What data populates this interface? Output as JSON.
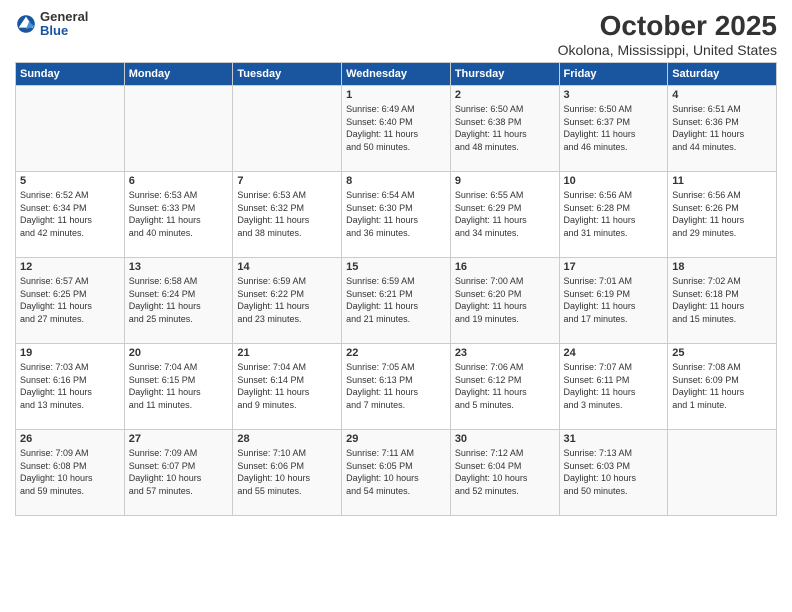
{
  "header": {
    "logo_general": "General",
    "logo_blue": "Blue",
    "title": "October 2025",
    "subtitle": "Okolona, Mississippi, United States"
  },
  "weekdays": [
    "Sunday",
    "Monday",
    "Tuesday",
    "Wednesday",
    "Thursday",
    "Friday",
    "Saturday"
  ],
  "rows": [
    [
      {
        "day": "",
        "info": ""
      },
      {
        "day": "",
        "info": ""
      },
      {
        "day": "",
        "info": ""
      },
      {
        "day": "1",
        "info": "Sunrise: 6:49 AM\nSunset: 6:40 PM\nDaylight: 11 hours\nand 50 minutes."
      },
      {
        "day": "2",
        "info": "Sunrise: 6:50 AM\nSunset: 6:38 PM\nDaylight: 11 hours\nand 48 minutes."
      },
      {
        "day": "3",
        "info": "Sunrise: 6:50 AM\nSunset: 6:37 PM\nDaylight: 11 hours\nand 46 minutes."
      },
      {
        "day": "4",
        "info": "Sunrise: 6:51 AM\nSunset: 6:36 PM\nDaylight: 11 hours\nand 44 minutes."
      }
    ],
    [
      {
        "day": "5",
        "info": "Sunrise: 6:52 AM\nSunset: 6:34 PM\nDaylight: 11 hours\nand 42 minutes."
      },
      {
        "day": "6",
        "info": "Sunrise: 6:53 AM\nSunset: 6:33 PM\nDaylight: 11 hours\nand 40 minutes."
      },
      {
        "day": "7",
        "info": "Sunrise: 6:53 AM\nSunset: 6:32 PM\nDaylight: 11 hours\nand 38 minutes."
      },
      {
        "day": "8",
        "info": "Sunrise: 6:54 AM\nSunset: 6:30 PM\nDaylight: 11 hours\nand 36 minutes."
      },
      {
        "day": "9",
        "info": "Sunrise: 6:55 AM\nSunset: 6:29 PM\nDaylight: 11 hours\nand 34 minutes."
      },
      {
        "day": "10",
        "info": "Sunrise: 6:56 AM\nSunset: 6:28 PM\nDaylight: 11 hours\nand 31 minutes."
      },
      {
        "day": "11",
        "info": "Sunrise: 6:56 AM\nSunset: 6:26 PM\nDaylight: 11 hours\nand 29 minutes."
      }
    ],
    [
      {
        "day": "12",
        "info": "Sunrise: 6:57 AM\nSunset: 6:25 PM\nDaylight: 11 hours\nand 27 minutes."
      },
      {
        "day": "13",
        "info": "Sunrise: 6:58 AM\nSunset: 6:24 PM\nDaylight: 11 hours\nand 25 minutes."
      },
      {
        "day": "14",
        "info": "Sunrise: 6:59 AM\nSunset: 6:22 PM\nDaylight: 11 hours\nand 23 minutes."
      },
      {
        "day": "15",
        "info": "Sunrise: 6:59 AM\nSunset: 6:21 PM\nDaylight: 11 hours\nand 21 minutes."
      },
      {
        "day": "16",
        "info": "Sunrise: 7:00 AM\nSunset: 6:20 PM\nDaylight: 11 hours\nand 19 minutes."
      },
      {
        "day": "17",
        "info": "Sunrise: 7:01 AM\nSunset: 6:19 PM\nDaylight: 11 hours\nand 17 minutes."
      },
      {
        "day": "18",
        "info": "Sunrise: 7:02 AM\nSunset: 6:18 PM\nDaylight: 11 hours\nand 15 minutes."
      }
    ],
    [
      {
        "day": "19",
        "info": "Sunrise: 7:03 AM\nSunset: 6:16 PM\nDaylight: 11 hours\nand 13 minutes."
      },
      {
        "day": "20",
        "info": "Sunrise: 7:04 AM\nSunset: 6:15 PM\nDaylight: 11 hours\nand 11 minutes."
      },
      {
        "day": "21",
        "info": "Sunrise: 7:04 AM\nSunset: 6:14 PM\nDaylight: 11 hours\nand 9 minutes."
      },
      {
        "day": "22",
        "info": "Sunrise: 7:05 AM\nSunset: 6:13 PM\nDaylight: 11 hours\nand 7 minutes."
      },
      {
        "day": "23",
        "info": "Sunrise: 7:06 AM\nSunset: 6:12 PM\nDaylight: 11 hours\nand 5 minutes."
      },
      {
        "day": "24",
        "info": "Sunrise: 7:07 AM\nSunset: 6:11 PM\nDaylight: 11 hours\nand 3 minutes."
      },
      {
        "day": "25",
        "info": "Sunrise: 7:08 AM\nSunset: 6:09 PM\nDaylight: 11 hours\nand 1 minute."
      }
    ],
    [
      {
        "day": "26",
        "info": "Sunrise: 7:09 AM\nSunset: 6:08 PM\nDaylight: 10 hours\nand 59 minutes."
      },
      {
        "day": "27",
        "info": "Sunrise: 7:09 AM\nSunset: 6:07 PM\nDaylight: 10 hours\nand 57 minutes."
      },
      {
        "day": "28",
        "info": "Sunrise: 7:10 AM\nSunset: 6:06 PM\nDaylight: 10 hours\nand 55 minutes."
      },
      {
        "day": "29",
        "info": "Sunrise: 7:11 AM\nSunset: 6:05 PM\nDaylight: 10 hours\nand 54 minutes."
      },
      {
        "day": "30",
        "info": "Sunrise: 7:12 AM\nSunset: 6:04 PM\nDaylight: 10 hours\nand 52 minutes."
      },
      {
        "day": "31",
        "info": "Sunrise: 7:13 AM\nSunset: 6:03 PM\nDaylight: 10 hours\nand 50 minutes."
      },
      {
        "day": "",
        "info": ""
      }
    ]
  ]
}
